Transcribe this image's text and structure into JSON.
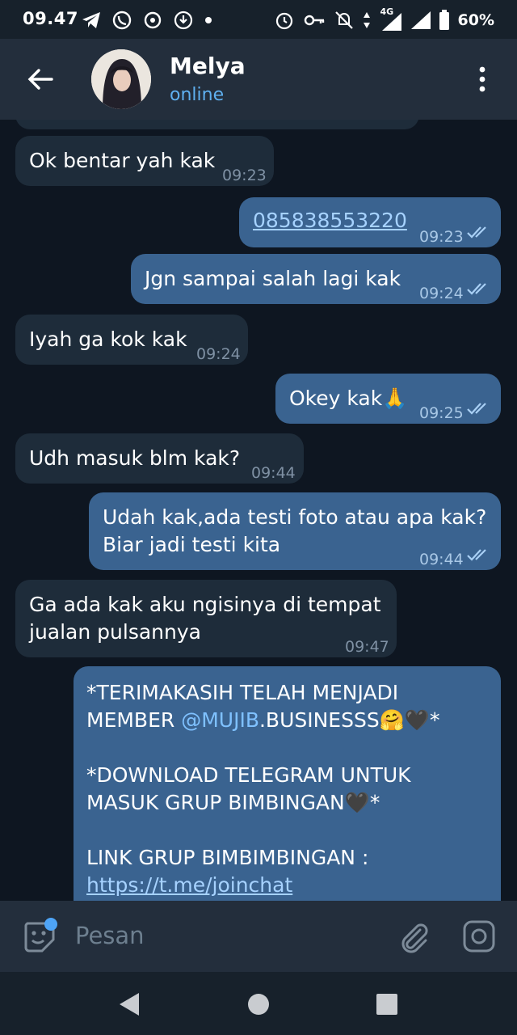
{
  "status_bar": {
    "time": "09.47",
    "network": "4G",
    "battery": "60%"
  },
  "header": {
    "contact_name": "Melya",
    "contact_status": "online"
  },
  "messages": [
    {
      "dir": "in",
      "text": "Ok bentar yah kak",
      "time": "09:23"
    },
    {
      "dir": "out",
      "text": "085838553220",
      "time": "09:23",
      "link": true
    },
    {
      "dir": "out",
      "text": "Jgn sampai salah lagi kak",
      "time": "09:24"
    },
    {
      "dir": "in",
      "text": "Iyah ga kok kak",
      "time": "09:24"
    },
    {
      "dir": "out",
      "text": "Okey kak🙏",
      "time": "09:25"
    },
    {
      "dir": "in",
      "text": "Udh masuk blm kak?",
      "time": "09:44"
    },
    {
      "dir": "out",
      "lines": [
        "Udah kak,ada testi foto atau apa kak?",
        "Biar jadi testi kita"
      ],
      "time": "09:44"
    },
    {
      "dir": "in",
      "lines": [
        "Ga ada kak aku ngisinya di tempat",
        "jualan pulsannya"
      ],
      "time": "09:47"
    },
    {
      "dir": "out",
      "lines": [
        "*TERIMAKASIH TELAH MENJADI",
        "MEMBER @MUJIB.BUSINESSS🤗🖤*",
        "",
        "*DOWNLOAD TELEGRAM UNTUK",
        "MASUK GRUP BIMBINGAN🖤*",
        "",
        "LINK GRUP BIMBIMBINGAN :",
        "https://t.me/joinchat"
      ]
    }
  ],
  "last_message_parts": {
    "line1": "*TERIMAKASIH TELAH MENJADI",
    "line2_prefix": "MEMBER ",
    "line2_mention": "@MUJIB",
    "line2_suffix": ".BUSINESSS🤗🖤*",
    "line3": "*DOWNLOAD TELEGRAM UNTUK",
    "line4": "MASUK GRUP BIMBINGAN🖤*",
    "line5": "LINK GRUP BIMBIMBINGAN :",
    "line6": "https://t.me/joinchat"
  },
  "composer": {
    "placeholder": "Pesan"
  },
  "colors": {
    "incoming_bubble": "#1e2c3a",
    "outgoing_bubble": "#3a6390",
    "online_status": "#5fb0f0",
    "header_bg": "#232e3c",
    "chat_bg": "#0e1621"
  }
}
